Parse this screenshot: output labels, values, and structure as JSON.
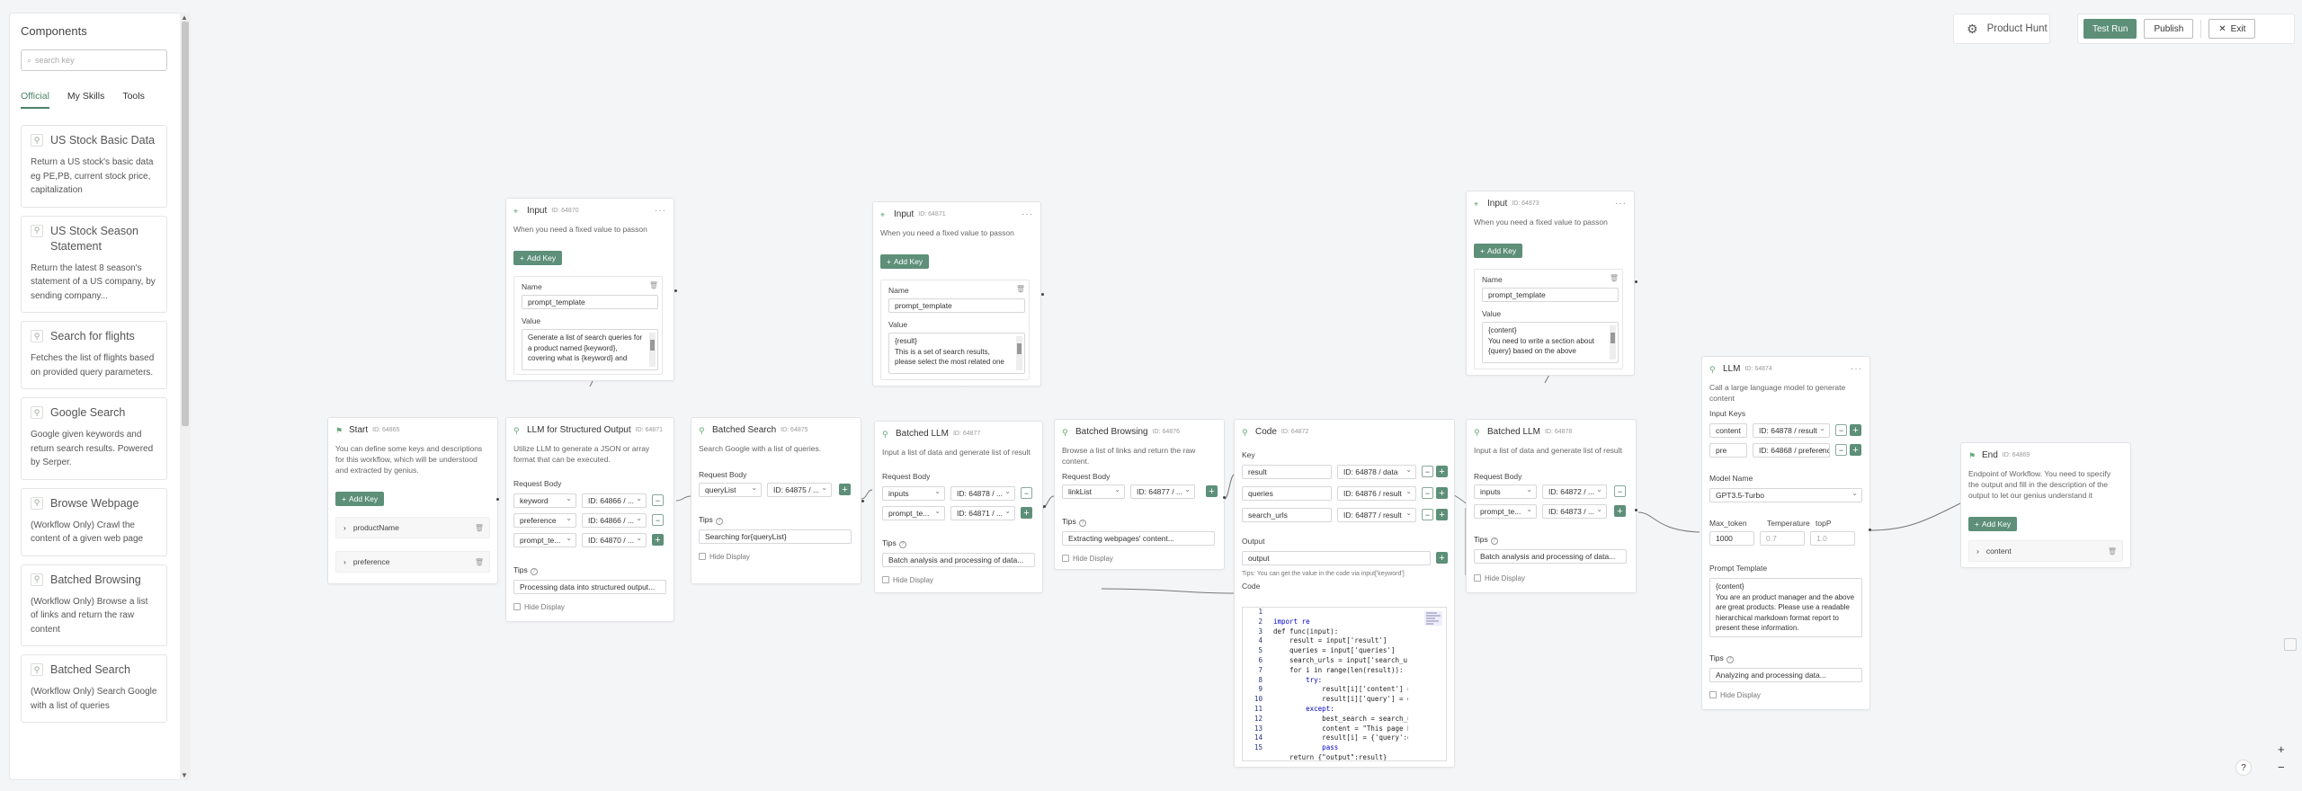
{
  "sidebar": {
    "title": "Components",
    "search_placeholder": "search key",
    "tabs": [
      {
        "label": "Official"
      },
      {
        "label": "My Skills"
      },
      {
        "label": "Tools"
      }
    ],
    "items": [
      {
        "title": "US Stock Basic Data",
        "desc": "Return a US stock's basic data eg PE,PB, current stock price, capitalization"
      },
      {
        "title": "US Stock Season Statement",
        "desc": "Return the latest 8 season's statement of a US company, by sending company..."
      },
      {
        "title": "Search for flights",
        "desc": "Fetches the list of flights based on provided query parameters."
      },
      {
        "title": "Google Search",
        "desc": "Google given keywords and return search results. Powered by Serper."
      },
      {
        "title": "Browse Webpage",
        "desc": "(Workflow Only) Crawl the content of a given web page"
      },
      {
        "title": "Batched Browsing",
        "desc": "(Workflow Only) Browse a list of links and return the raw content"
      },
      {
        "title": "Batched Search",
        "desc": "(Workflow Only) Search Google with a list of queries"
      }
    ]
  },
  "topbar": {
    "product_hunt": "Product Hunt",
    "test_run": "Test Run",
    "publish": "Publish",
    "exit": "Exit"
  },
  "help": "?",
  "zoom": {
    "in": "+",
    "out": "−"
  },
  "common": {
    "add_key": "Add Key",
    "name": "Name",
    "value": "Value",
    "request_body": "Request Body",
    "tips": "Tips",
    "hide_display": "Hide Display",
    "key": "Key",
    "output": "Output",
    "code": "Code",
    "code_hint": "Tips: You can get the value in the code via input['keyword']",
    "input_keys": "Input Keys",
    "model_name": "Model Name",
    "max_token": "Max_token",
    "temperature": "Temperature",
    "topp": "topP",
    "prompt_template": "Prompt Template",
    "dots": "···"
  },
  "nodes": {
    "start": {
      "title": "Start",
      "id": "ID: 64865",
      "desc": "You can define some keys and descriptions for this workflow, which will be understood and extracted by genius.",
      "keys": [
        "productName",
        "preference"
      ]
    },
    "input1": {
      "title": "Input",
      "id": "ID: 64870",
      "desc": "When you need a fixed value to passon",
      "name_val": "prompt_template",
      "value_text": "Generate a list of search queries for a product named {keyword}, covering what is {keyword} and"
    },
    "llm_struct": {
      "title": "LLM for Structured Output",
      "id": "ID: 64871",
      "desc": "Utilize LLM to generate a JSON or array format that can be executed.",
      "rows": [
        {
          "key": "keyword",
          "ref": "ID: 64866 / ..."
        },
        {
          "key": "preference",
          "ref": "ID: 64866 / ..."
        },
        {
          "key": "prompt_te...",
          "ref": "ID: 64870 / ..."
        }
      ],
      "tips_val": "Processing data into structured output..."
    },
    "bsearch": {
      "title": "Batched Search",
      "id": "ID: 64875",
      "desc": "Search Google with a list of queries.",
      "row": {
        "key": "queryList",
        "ref": "ID: 64875 / ..."
      },
      "tips_val": "Searching for{queryList}"
    },
    "input2": {
      "title": "Input",
      "id": "ID: 64871",
      "desc": "When you need a fixed value to passon",
      "name_val": "prompt_template",
      "value_text": "{result}\nThis is a set of search results, please select the most related one"
    },
    "bllm1": {
      "title": "Batched LLM",
      "id": "ID: 64877",
      "desc": "Input a list of data and generate list of result",
      "rows": [
        {
          "key": "inputs",
          "ref": "ID: 64878 / ..."
        },
        {
          "key": "prompt_te...",
          "ref": "ID: 64871 / ..."
        }
      ],
      "tips_val": "Batch analysis and processing of data..."
    },
    "bbrowse": {
      "title": "Batched Browsing",
      "id": "ID: 64876",
      "desc": "Browse a list of links and return the raw content.",
      "row": {
        "key": "linkList",
        "ref": "ID: 64877 / ..."
      },
      "tips_val": "Extracting webpages' content..."
    },
    "code": {
      "title": "Code",
      "id": "ID: 64872",
      "keys": [
        {
          "key": "result",
          "ref": "ID: 64878 / data"
        },
        {
          "key": "queries",
          "ref": "ID: 64876 / result"
        },
        {
          "key": "search_urls",
          "ref": "ID: 64877 / result"
        }
      ],
      "output": "output",
      "lines": [
        "import re",
        "def func(input):",
        "    result = input['result']",
        "    queries = input['queries']",
        "    search_urls = input['search_ur",
        "    for i in range(len(result)):",
        "        try:",
        "            result[i]['content'] =",
        "            result[i]['query'] = q",
        "        except:",
        "            best_search = search_u",
        "            content = \"This page h",
        "            result[i] = {'query':q",
        "            pass",
        "    return {\"output\":result}"
      ]
    },
    "input3": {
      "title": "Input",
      "id": "ID: 64873",
      "desc": "When you need a fixed value to passon",
      "name_val": "prompt_template",
      "value_text": "{content}\nYou need to write a section about {query} based on the above"
    },
    "bllm2": {
      "title": "Batched LLM",
      "id": "ID: 64878",
      "desc": "Input a list of data and generate list of result",
      "rows": [
        {
          "key": "inputs",
          "ref": "ID: 64872 / ..."
        },
        {
          "key": "prompt_te...",
          "ref": "ID: 64873 / ..."
        }
      ],
      "tips_val": "Batch analysis and processing of data..."
    },
    "llm": {
      "title": "LLM",
      "id": "ID: 64874",
      "desc": "Call a large language model to generate content",
      "rows": [
        {
          "key": "content",
          "ref": "ID: 64878 / result"
        },
        {
          "key": "pre",
          "ref": "ID: 64868 / preference"
        }
      ],
      "model": "GPT3.5-Turbo",
      "max_token": "1000",
      "temperature": "0.7",
      "topp": "1.0",
      "prompt": "{content}\nYou are an product manager and the above are great products. Please use a readable hierarchical markdown format report to present these information.",
      "tips_val": "Analyzing and processing data..."
    },
    "end": {
      "title": "End",
      "id": "ID: 64869",
      "desc": "Endpoint of Workflow. You need to specify the output and fill in the description of the output to let our genius understand it",
      "keys": [
        "content"
      ]
    }
  }
}
